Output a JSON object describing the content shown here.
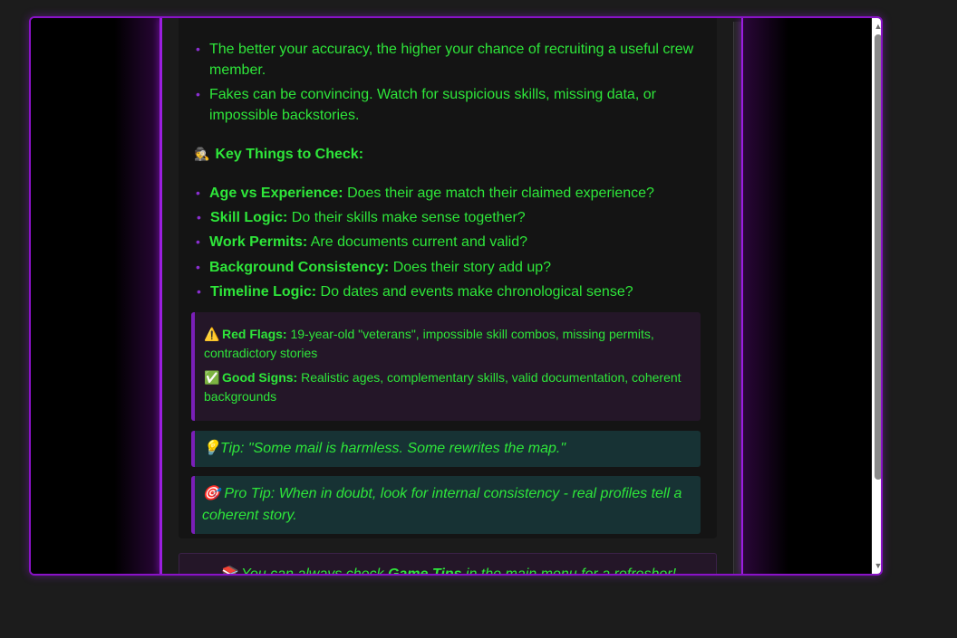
{
  "intro_bullets": [
    "The better your accuracy, the higher your chance of recruiting a useful crew member.",
    "Fakes can be convincing. Watch for suspicious skills, missing data, or impossible backstories."
  ],
  "check_section": {
    "icon": "🕵",
    "title": "Key Things to Check:",
    "items": [
      {
        "label": "Age vs Experience:",
        "text": " Does their age match their claimed experience?"
      },
      {
        "label": "Skill Logic:",
        "text": " Do their skills make sense together?"
      },
      {
        "label": "Work Permits:",
        "text": " Are documents current and valid?"
      },
      {
        "label": "Background Consistency:",
        "text": " Does their story add up?"
      },
      {
        "label": "Timeline Logic:",
        "text": " Do dates and events make chronological sense?"
      }
    ]
  },
  "flags": {
    "red": {
      "icon": "⚠️",
      "label": "Red Flags:",
      "text": " 19-year-old \"veterans\", impossible skill combos, missing permits, contradictory stories"
    },
    "good": {
      "icon": "✅",
      "label": "Good Signs:",
      "text": " Realistic ages, complementary skills, valid documentation, coherent backgrounds"
    }
  },
  "tips": [
    {
      "icon": "💡",
      "text": "Tip: \"Some mail is harmless. Some rewrites the map.\""
    },
    {
      "icon": "🎯",
      "text": "Pro Tip: When in doubt, look for internal consistency - real profiles tell a coherent story."
    }
  ],
  "footer": {
    "icon": "📚",
    "pre": "You can always check ",
    "strong": "Game Tips",
    "post": " in the main menu for a refresher!"
  },
  "colors": {
    "text_green": "#2ee63a",
    "accent_purple": "#8a12c8",
    "tip_bg": "#173234",
    "flag_bg": "#241628"
  }
}
